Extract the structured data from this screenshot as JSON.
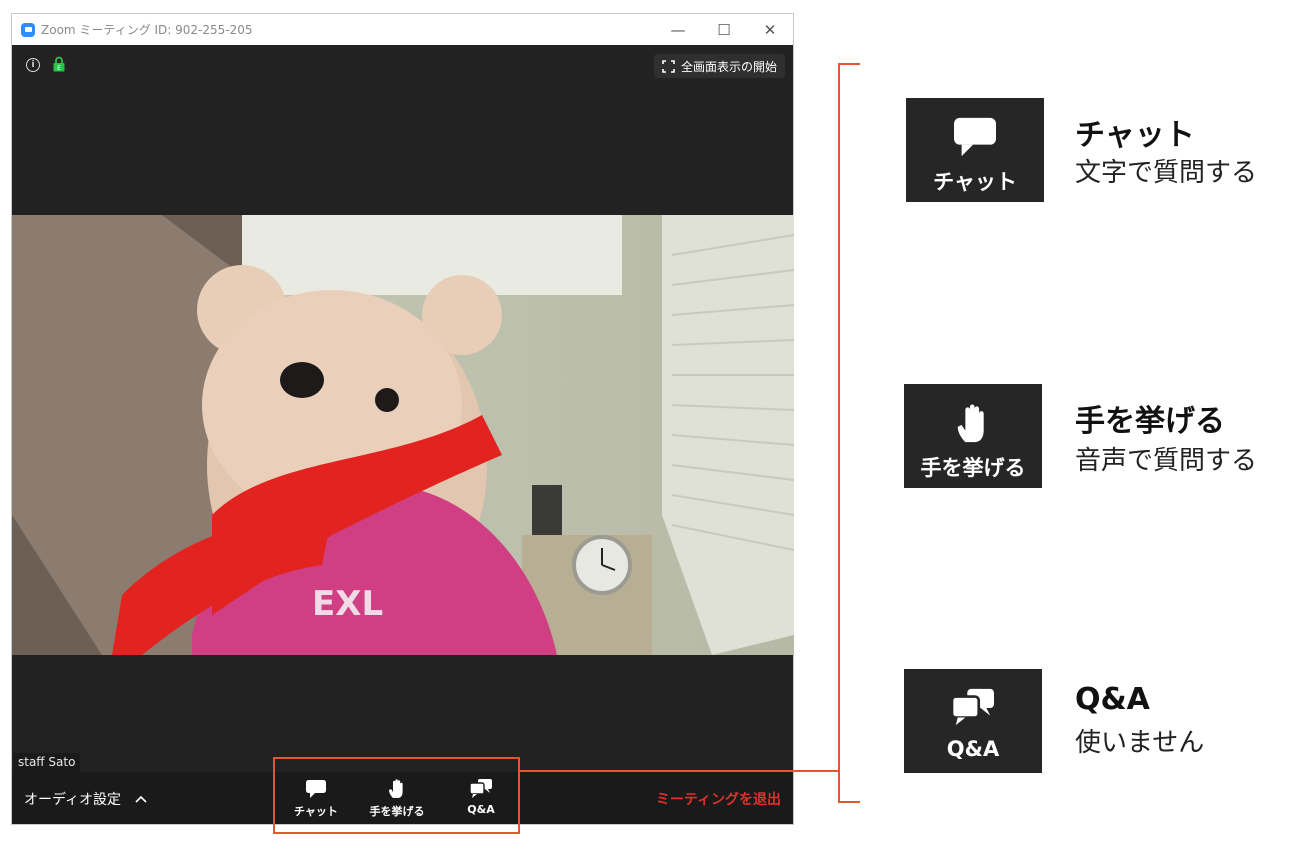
{
  "window": {
    "title": "Zoom ミーティング ID: 902-255-205",
    "controls": {
      "minimize": "—",
      "maximize": "☐",
      "close": "✕"
    }
  },
  "top_bar": {
    "info_icon": "info-icon",
    "lock_icon": "lock-icon",
    "lock_letter": "E",
    "fullscreen_label": "全画面表示の開始"
  },
  "video": {
    "participant_name": "staff Sato"
  },
  "toolbar": {
    "audio_label": "オーディオ設定",
    "chat_label": "チャット",
    "raise_hand_label": "手を挙げる",
    "qa_label": "Q&A",
    "leave_label": "ミーティングを退出"
  },
  "callouts": [
    {
      "tile_label": "チャット",
      "icon": "chat-icon",
      "title": "チャット",
      "description": "文字で質問する"
    },
    {
      "tile_label": "手を挙げる",
      "icon": "raise-hand-icon",
      "title": "手を挙げる",
      "description": "音声で質問する"
    },
    {
      "tile_label": "Q&A",
      "icon": "qa-icon",
      "title": "Q&A",
      "description": "使いません"
    }
  ],
  "colors": {
    "accent": "#e0582b",
    "leave": "#e0302b",
    "zoom_blue": "#2d8cff",
    "dark_bg": "#222222"
  }
}
